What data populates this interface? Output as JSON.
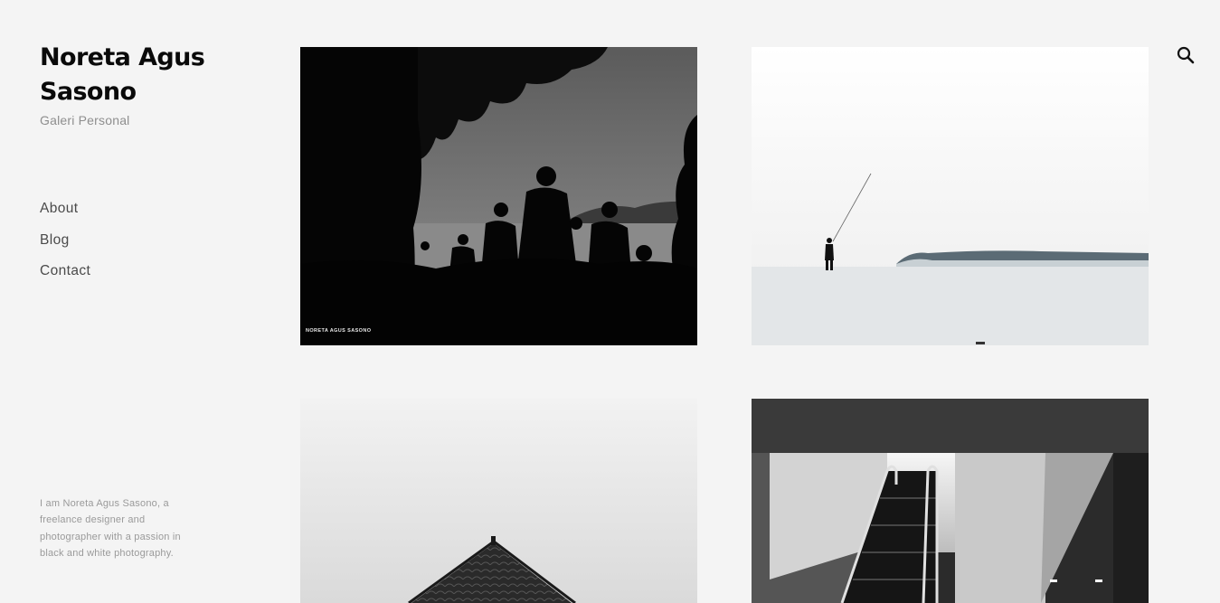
{
  "site": {
    "title_line1": "Noreta Agus",
    "title_line2": "Sasono",
    "tagline": "Galeri Personal"
  },
  "nav": {
    "items": [
      {
        "label": "About"
      },
      {
        "label": "Blog"
      },
      {
        "label": "Contact"
      }
    ]
  },
  "bio": {
    "text": "I am Noreta Agus Sasono, a freelance designer and photographer with a passion in black and white photography."
  },
  "search": {
    "icon": "search-icon"
  },
  "gallery": {
    "items": [
      {
        "subject": "silhouettes-at-beach",
        "watermark": "NORETA AGUS SASONO"
      },
      {
        "subject": "fisherman-casting-by-waves"
      },
      {
        "subject": "roof-against-sky"
      },
      {
        "subject": "escalator"
      }
    ]
  },
  "colors": {
    "background": "#f4f4f4",
    "title": "#0a0a0a",
    "tagline": "#8e8e8e",
    "nav": "#4a4a4a",
    "bio": "#9a9a9a"
  }
}
